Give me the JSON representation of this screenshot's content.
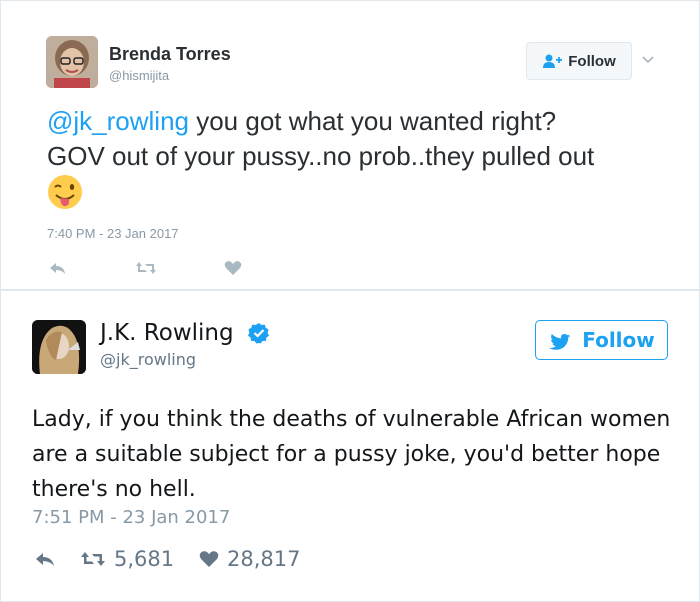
{
  "tweet1": {
    "author_name": "Brenda Torres",
    "author_handle": "@hismijita",
    "follow_label": "Follow",
    "mention": "@jk_rowling",
    "text_part1": " you got what you wanted right?",
    "text_part2": "GOV out of your pussy..no prob..they pulled out",
    "timestamp": "7:40 PM - 23 Jan 2017"
  },
  "tweet2": {
    "author_name": "J.K. Rowling",
    "author_handle": "@jk_rowling",
    "follow_label": "Follow",
    "text": "Lady, if you think the deaths of vulnerable African women are a suitable subject for a pussy joke, you'd better hope there's no hell.",
    "timestamp": "7:51 PM - 23 Jan 2017",
    "retweets": "5,681",
    "likes": "28,817"
  },
  "colors": {
    "link_blue": "#1da1f2",
    "muted_gray": "#8899a6"
  }
}
